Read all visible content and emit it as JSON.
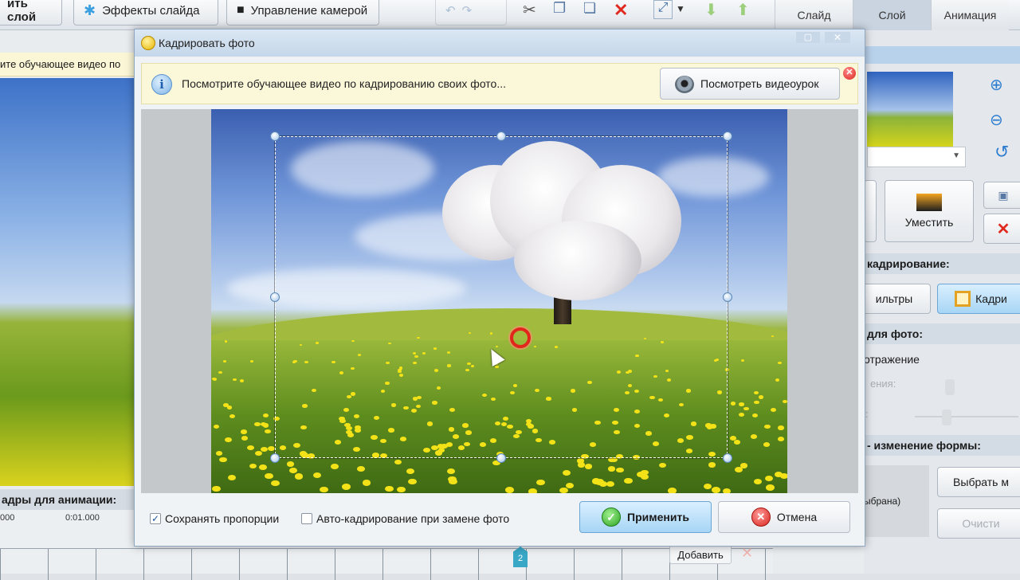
{
  "toolbar": {
    "add_layer_label": "ить слой",
    "slide_effects_label": "Эффекты слайда",
    "camera_control_label": "Управление камерой"
  },
  "tabs": [
    "Слайд",
    "Слой",
    "Анимация"
  ],
  "left_info_text": "ите обучающее видео по",
  "frames_label": "адры для анимации:",
  "timeline": {
    "t0": "000",
    "t1": "0:01.000",
    "add_label": "Добавить",
    "marker": "2"
  },
  "right_panel": {
    "fit_label": "Уместить",
    "crop_section": "кадрирование:",
    "filters_label": "ильтры",
    "crop_label": "Кадри",
    "for_photo_section": "для фото:",
    "mirror_label": "отражение",
    "rotation_label": "ения:",
    "scale_label": ":",
    "shape_section": "- изменение формы:",
    "choose_label": "Выбрать м",
    "not_selected": "ыбрана)",
    "clear_label": "Очисти"
  },
  "dialog": {
    "title": "Кадрировать фото",
    "info_text": "Посмотрите обучающее видео по кадрированию своих фото...",
    "watch_button": "Посмотреть видеоурок",
    "keep_proportions": "Сохранять пропорции",
    "keep_proportions_checked": true,
    "auto_crop": "Авто-кадрирование при замене фото",
    "auto_crop_checked": false,
    "apply": "Применить",
    "cancel": "Отмена"
  },
  "icons": {
    "title_icon": "smiley-icon",
    "info_icon": "info-icon",
    "watch_icon": "webcam-icon",
    "close_info_icon": "close-icon",
    "apply_icon": "checkmark-icon",
    "cancel_icon": "cancel-icon"
  },
  "colors": {
    "accent": "#a7d5f5",
    "info_bar": "#fbf7d9",
    "crop_border": "#ffffff"
  }
}
